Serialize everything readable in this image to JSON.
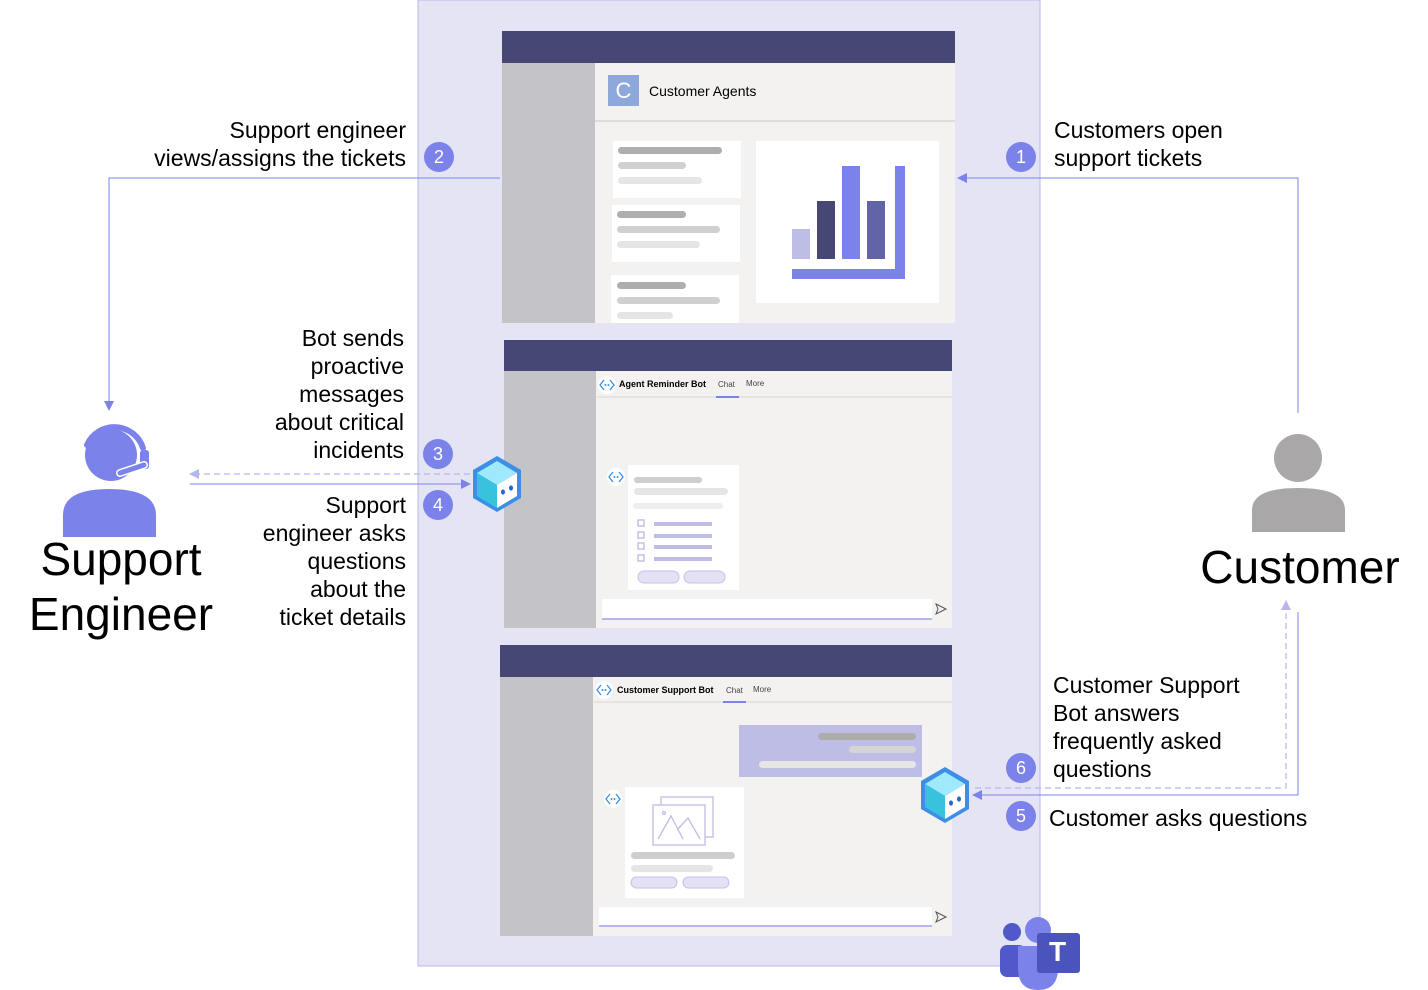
{
  "actors": {
    "support_engineer": "Support\nEngineer",
    "customer": "Customer"
  },
  "steps": [
    {
      "number": "1",
      "text": "Customers open\nsupport tickets"
    },
    {
      "number": "2",
      "text": "Support engineer\nviews/assigns the tickets"
    },
    {
      "number": "3",
      "text": "Bot sends\nproactive\nmessages\nabout critical\nincidents"
    },
    {
      "number": "4",
      "text": "Support\nengineer asks\nquestions\nabout the\nticket details"
    },
    {
      "number": "5",
      "text": "Customer asks questions"
    },
    {
      "number": "6",
      "text": "Customer Support\nBot answers\nfrequently asked\nquestions"
    }
  ],
  "apps": {
    "tab_app": {
      "logo_letter": "C",
      "title": "Customer Agents"
    },
    "reminder_bot": {
      "title": "Agent Reminder Bot",
      "tabs": [
        "Chat",
        "More"
      ]
    },
    "support_bot": {
      "title": "Customer Support Bot",
      "tabs": [
        "Chat",
        "More"
      ]
    }
  },
  "teams_logo_letter": "T",
  "colors": {
    "accent": "#7b83eb",
    "header": "#464775",
    "background_panel": "#e5e4f5",
    "sidebar": "#c4c3c8",
    "content": "#f3f2f1",
    "customer_icon": "#a9a7a8"
  },
  "icons": [
    "headset-person-icon",
    "person-icon",
    "bot-cube-icon",
    "bot-avatar-icon",
    "send-icon",
    "bar-chart-icon",
    "image-icon",
    "teams-logo-icon"
  ]
}
